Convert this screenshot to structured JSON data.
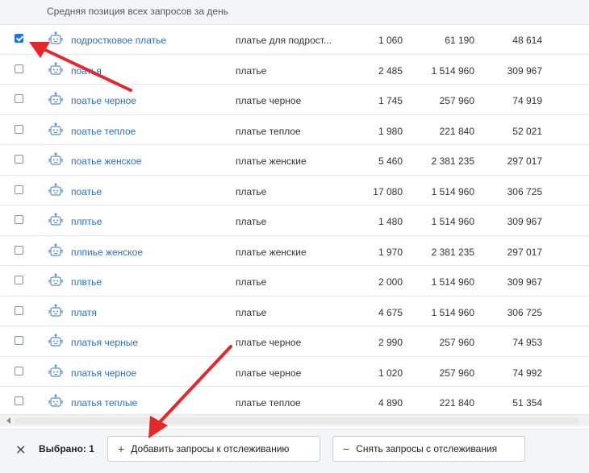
{
  "header": {
    "title": "Средняя позиция всех запросов за день"
  },
  "rows": [
    {
      "query": "подростковое платье",
      "match": "платье для подрост...",
      "v1": "1 060",
      "v2": "61 190",
      "v3": "48 614",
      "checked": true
    },
    {
      "query": "поатья",
      "match": "платье",
      "v1": "2 485",
      "v2": "1 514 960",
      "v3": "309 967",
      "checked": false
    },
    {
      "query": "поатье черное",
      "match": "платье черное",
      "v1": "1 745",
      "v2": "257 960",
      "v3": "74 919",
      "checked": false
    },
    {
      "query": "поатье теплое",
      "match": "платье теплое",
      "v1": "1 980",
      "v2": "221 840",
      "v3": "52 021",
      "checked": false
    },
    {
      "query": "поатье женское",
      "match": "платье женские",
      "v1": "5 460",
      "v2": "2 381 235",
      "v3": "297 017",
      "checked": false
    },
    {
      "query": "поатье",
      "match": "платье",
      "v1": "17 080",
      "v2": "1 514 960",
      "v3": "306 725",
      "checked": false
    },
    {
      "query": "плптье",
      "match": "платье",
      "v1": "1 480",
      "v2": "1 514 960",
      "v3": "309 967",
      "checked": false
    },
    {
      "query": "плпиье женское",
      "match": "платье женские",
      "v1": "1 970",
      "v2": "2 381 235",
      "v3": "297 017",
      "checked": false
    },
    {
      "query": "плвтье",
      "match": "платье",
      "v1": "2 000",
      "v2": "1 514 960",
      "v3": "309 967",
      "checked": false
    },
    {
      "query": "платя",
      "match": "платье",
      "v1": "4 675",
      "v2": "1 514 960",
      "v3": "306 725",
      "checked": false
    },
    {
      "query": "платья черные",
      "match": "платье черное",
      "v1": "2 990",
      "v2": "257 960",
      "v3": "74 953",
      "checked": false
    },
    {
      "query": "платья черное",
      "match": "платье черное",
      "v1": "1 020",
      "v2": "257 960",
      "v3": "74 992",
      "checked": false
    },
    {
      "query": "платья теплые",
      "match": "платье теплое",
      "v1": "4 890",
      "v2": "221 840",
      "v3": "51 354",
      "checked": false
    }
  ],
  "icons": {
    "row_icon": "robot-icon",
    "close": "close-icon",
    "add": "plus-icon",
    "remove": "minus-icon",
    "scroll": "scroll-left-arrow-icon"
  },
  "footer": {
    "close_symbol": "×",
    "selected_label": "Выбрано: 1",
    "add_symbol": "+",
    "add_label": "Добавить запросы к отслеживанию",
    "remove_symbol": "−",
    "remove_label": "Снять запросы с отслеживания"
  },
  "colors": {
    "link": "#2b6fcf",
    "checkbox": "#1a73e8",
    "annotation_arrow": "#e5262a",
    "robot_icon": "#5b8fd6"
  }
}
